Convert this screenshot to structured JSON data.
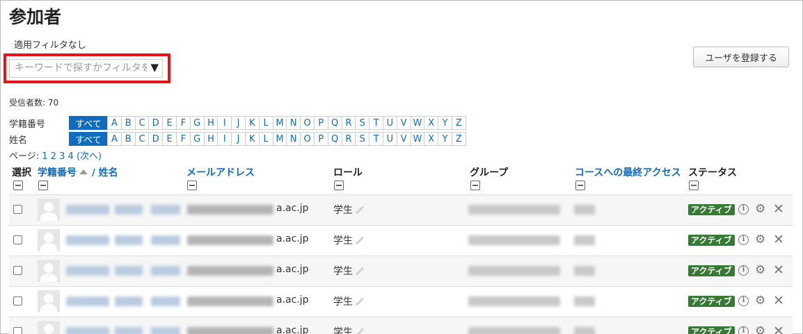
{
  "page_title": "参加者",
  "filter": {
    "applied_label": "適用フィルタなし",
    "placeholder": "キーワードで探すかフィルタを選",
    "dropdown_caret": "▼"
  },
  "enrol_button": "ユーザを登録する",
  "recipients": "受信者数: 70",
  "alphabet_rows": [
    {
      "label": "学籍番号",
      "all": "すべて"
    },
    {
      "label": "姓名",
      "all": "すべて"
    }
  ],
  "letters": [
    "A",
    "B",
    "C",
    "D",
    "E",
    "F",
    "G",
    "H",
    "I",
    "J",
    "K",
    "L",
    "M",
    "N",
    "O",
    "P",
    "Q",
    "R",
    "S",
    "T",
    "U",
    "V",
    "W",
    "X",
    "Y",
    "Z"
  ],
  "pager": {
    "label": "ページ:",
    "pages": [
      "1",
      "2",
      "3",
      "4"
    ],
    "next": "(次へ)"
  },
  "columns": {
    "select": "選択",
    "student_id": "学籍番号",
    "name_separator": "/",
    "name": "姓名",
    "email": "メールアドレス",
    "role": "ロール",
    "group": "グループ",
    "last_access": "コースへの最終アクセス",
    "status": "ステータス"
  },
  "rows": [
    {
      "email_suffix": "a.ac.jp",
      "role": "学生",
      "status": "アクティブ"
    },
    {
      "email_suffix": "a.ac.jp",
      "role": "学生",
      "status": "アクティブ"
    },
    {
      "email_suffix": "a.ac.jp",
      "role": "学生",
      "status": "アクティブ"
    },
    {
      "email_suffix": "a.ac.jp",
      "role": "学生",
      "status": "アクティブ"
    },
    {
      "email_suffix": "a.ac.jp",
      "role": "学生",
      "status": "アクティブ"
    }
  ],
  "colors": {
    "link": "#0f6cbf",
    "badge": "#357a32",
    "highlight": "#e8131a"
  }
}
